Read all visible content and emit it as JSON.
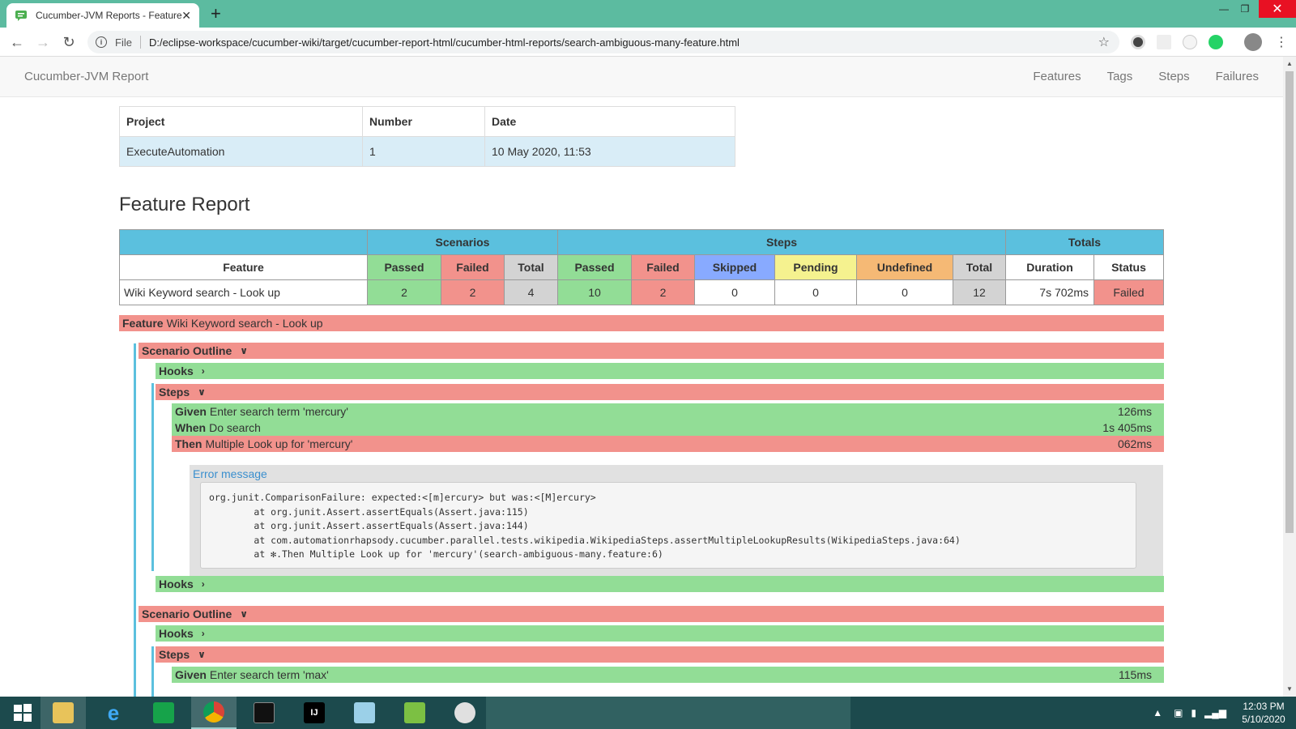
{
  "browser": {
    "tab_title": "Cucumber-JVM Reports - Feature",
    "tab_close": "✕",
    "new_tab": "+",
    "file_label": "File",
    "url": "D:/eclipse-workspace/cucumber-wiki/target/cucumber-report-html/cucumber-html-reports/search-ambiguous-many-feature.html"
  },
  "navbar": {
    "brand": "Cucumber-JVM Report",
    "links": [
      "Features",
      "Tags",
      "Steps",
      "Failures"
    ]
  },
  "info_table": {
    "headers": [
      "Project",
      "Number",
      "Date"
    ],
    "values": [
      "ExecuteAutomation",
      "1",
      "10 May 2020, 11:53"
    ]
  },
  "report_title": "Feature Report",
  "stats": {
    "groups": [
      "Scenarios",
      "Steps",
      "Totals"
    ],
    "headers": [
      "Feature",
      "Passed",
      "Failed",
      "Total",
      "Passed",
      "Failed",
      "Skipped",
      "Pending",
      "Undefined",
      "Total",
      "Duration",
      "Status"
    ],
    "row": [
      "Wiki Keyword search - Look up",
      "2",
      "2",
      "4",
      "10",
      "2",
      "0",
      "0",
      "0",
      "12",
      "7s 702ms",
      "Failed"
    ]
  },
  "feature": {
    "keyword": "Feature",
    "name": "Wiki Keyword search - Look up"
  },
  "scenario_label": "Scenario Outline",
  "hooks_label": "Hooks",
  "steps_label": "Steps",
  "scenario1_steps": [
    {
      "keyword": "Given",
      "text": "Enter search term 'mercury'",
      "duration": "126ms",
      "status": "passed"
    },
    {
      "keyword": "When",
      "text": "Do search",
      "duration": "1s 405ms",
      "status": "passed"
    },
    {
      "keyword": "Then",
      "text": "Multiple Look up for 'mercury'",
      "duration": "062ms",
      "status": "failed"
    }
  ],
  "error": {
    "link": "Error message",
    "text": "org.junit.ComparisonFailure: expected:<[m]ercury> but was:<[M]ercury>\n\tat org.junit.Assert.assertEquals(Assert.java:115)\n\tat org.junit.Assert.assertEquals(Assert.java:144)\n\tat com.automationrhapsody.cucumber.parallel.tests.wikipedia.WikipediaSteps.assertMultipleLookupResults(WikipediaSteps.java:64)\n\tat ✻.Then Multiple Look up for 'mercury'(search-ambiguous-many.feature:6)"
  },
  "scenario2_steps": [
    {
      "keyword": "Given",
      "text": "Enter search term 'max'",
      "duration": "115ms",
      "status": "passed"
    }
  ],
  "taskbar": {
    "time": "12:03 PM",
    "date": "5/10/2020"
  },
  "colors": {
    "passed": "#92dd96",
    "failed": "#f2928c",
    "header_blue": "#5bc0de",
    "chrome_frame": "#5cbba0"
  }
}
